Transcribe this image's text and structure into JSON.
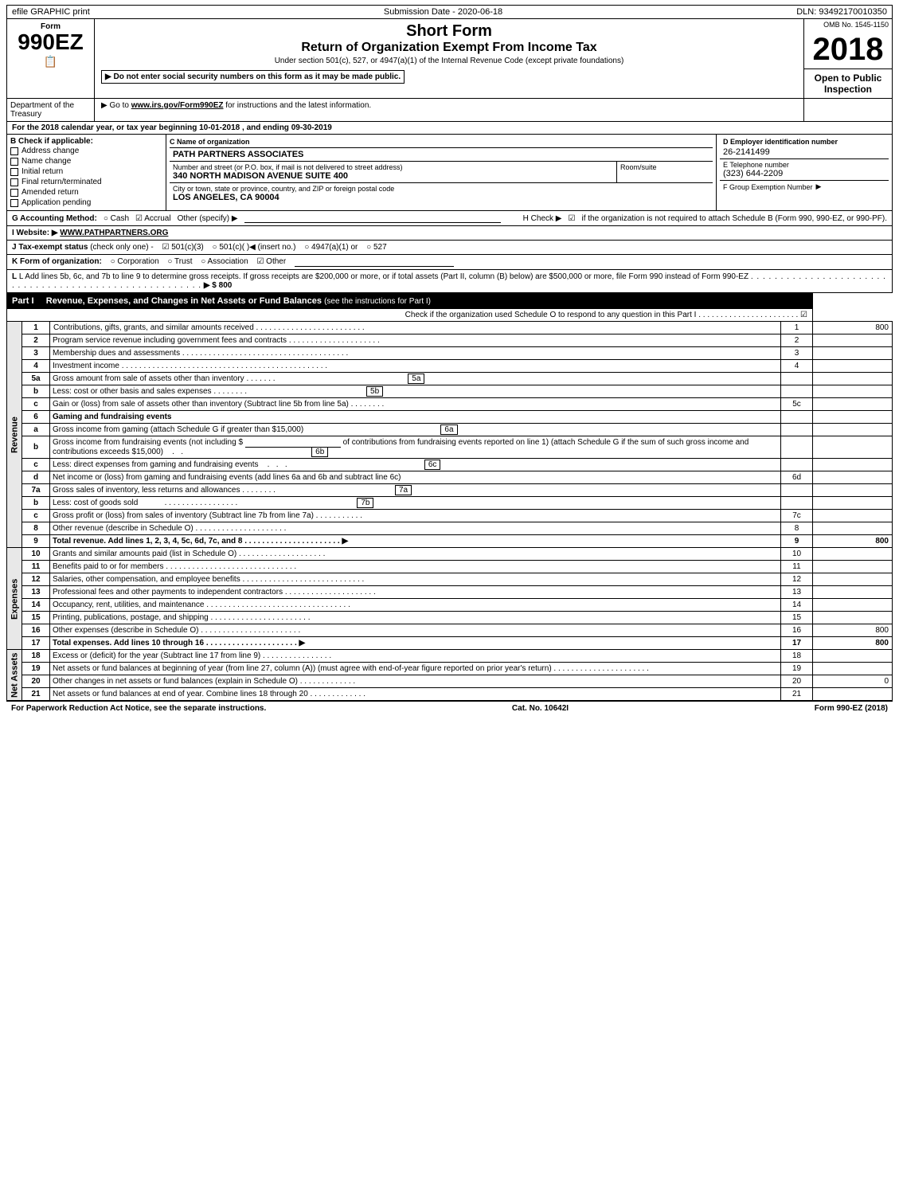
{
  "header": {
    "efile_label": "efile GRAPHIC print",
    "submission_label": "Submission Date - 2020-06-18",
    "dln_label": "DLN: 93492170010350"
  },
  "form": {
    "label": "Form",
    "number": "990EZ",
    "omb": "OMB No. 1545-1150",
    "short_form": "Short Form",
    "return_title": "Return of Organization Exempt From Income Tax",
    "under_section": "Under section 501(c), 527, or 4947(a)(1) of the Internal Revenue Code (except private foundations)",
    "do_not_enter": "▶ Do not enter social security numbers on this form as it may be made public.",
    "go_to": "▶ Go to",
    "go_to_link": "www.irs.gov/Form990EZ",
    "go_to_rest": "for instructions and the latest information.",
    "year": "2018",
    "open_to_public": "Open to Public Inspection"
  },
  "treasury": {
    "label": "Department of the Treasury"
  },
  "calendar": {
    "label": "For the 2018 calendar year, or tax year beginning 10-01-2018",
    "ending": ", and ending 09-30-2019"
  },
  "check": {
    "label": "B Check if applicable:",
    "options": [
      {
        "id": "address",
        "label": "Address change",
        "checked": false
      },
      {
        "id": "name",
        "label": "Name change",
        "checked": false
      },
      {
        "id": "initial",
        "label": "Initial return",
        "checked": false
      },
      {
        "id": "final",
        "label": "Final return/terminated",
        "checked": false
      },
      {
        "id": "amended",
        "label": "Amended return",
        "checked": false
      },
      {
        "id": "application",
        "label": "Application pending",
        "checked": false
      }
    ]
  },
  "org": {
    "c_label": "C Name of organization",
    "name": "PATH PARTNERS ASSOCIATES",
    "address_label": "Number and street (or P.O. box, if mail is not delivered to street address)",
    "address": "340 NORTH MADISON AVENUE SUITE 400",
    "room_label": "Room/suite",
    "room": "",
    "city_label": "City or town, state or province, country, and ZIP or foreign postal code",
    "city": "LOS ANGELES, CA  90004",
    "d_label": "D Employer identification number",
    "ein": "26-2141499",
    "e_label": "E Telephone number",
    "phone": "(323) 644-2209",
    "f_label": "F Group Exemption Number",
    "group_num": ""
  },
  "accounting": {
    "g_label": "G Accounting Method:",
    "cash": "○ Cash",
    "accrual": "☑ Accrual",
    "other": "Other (specify) ▶",
    "h_label": "H  Check ▶",
    "h_check": "☑",
    "h_text": "if the organization is not required to attach Schedule B (Form 990, 990-EZ, or 990-PF)."
  },
  "website": {
    "i_label": "I Website: ▶",
    "url": "WWW.PATHPARTNERS.ORG"
  },
  "tax_status": {
    "j_label": "J Tax-exempt status",
    "check_only": "(check only one) -",
    "options": [
      {
        "label": "☑ 501(c)(3)",
        "selected": true
      },
      {
        "label": "○ 501(c)(  )◀ (insert no.)",
        "selected": false
      },
      {
        "label": "○ 4947(a)(1) or",
        "selected": false
      },
      {
        "label": "○ 527",
        "selected": false
      }
    ]
  },
  "form_org": {
    "k_label": "K Form of organization:",
    "options": [
      {
        "label": "○ Corporation",
        "selected": false
      },
      {
        "label": "○ Trust",
        "selected": false
      },
      {
        "label": "○ Association",
        "selected": false
      },
      {
        "label": "☑ Other",
        "selected": true
      }
    ]
  },
  "add_lines": {
    "l_label": "L Add lines 5b, 6c, and 7b to line 9 to determine gross receipts. If gross receipts are $200,000 or more, or if total assets (Part II, column (B) below) are $500,000 or more, file Form 990 instead of Form 990-EZ",
    "dots": ". . . . . . . . . . . . . . . . . . . . . . . . . . . . . . . . . . . . . . . . . . . . . . . . . . . . . . . . . . . . . .",
    "arrow": "▶ $ 800"
  },
  "part1": {
    "label": "Part I",
    "title": "Revenue, Expenses, and Changes in Net Assets or Fund Balances",
    "subtitle": "(see the instructions for Part I)",
    "schedule_o_text": "Check if the organization used Schedule O to respond to any question in this Part I . . . . . . . . . . . . . . . . . . . . . . .",
    "schedule_o_check": "☑",
    "rows": [
      {
        "num": "1",
        "desc": "Contributions, gifts, grants, and similar amounts received . . . . . . . . . . . . . . . . . . . . . . . . . .",
        "line": "1",
        "amount": "800",
        "bold": false
      },
      {
        "num": "2",
        "desc": "Program service revenue including government fees and contracts . . . . . . . . . . . . . . . . . . . . . . . .",
        "line": "2",
        "amount": "",
        "bold": false
      },
      {
        "num": "3",
        "desc": "Membership dues and assessments . . . . . . . . . . . . . . . . . . . . . . . . . . . . . . . . . . . . . . .",
        "line": "3",
        "amount": "",
        "bold": false
      },
      {
        "num": "4",
        "desc": "Investment income . . . . . . . . . . . . . . . . . . . . . . . . . . . . . . . . . . . . . . . . . . . . . . .",
        "line": "4",
        "amount": "",
        "bold": false
      },
      {
        "num": "5a",
        "desc": "Gross amount from sale of assets other than inventory  .  .  .  .  .  .  .",
        "line": "5a",
        "amount": "",
        "bold": false,
        "sub": true
      },
      {
        "num": "b",
        "desc": "Less: cost or other basis and sales expenses  .  .  .  .  .  .  .  .",
        "line": "5b",
        "amount": "",
        "bold": false,
        "sub": true
      },
      {
        "num": "c",
        "desc": "Gain or (loss) from sale of assets other than inventory (Subtract line 5b from line 5a)  .  .  .  .  .  .  .  .",
        "line": "5c",
        "amount": "",
        "bold": false
      },
      {
        "num": "6",
        "desc": "Gaming and fundraising events",
        "line": "",
        "amount": "",
        "bold": false
      },
      {
        "num": "a",
        "desc": "Gross income from gaming (attach Schedule G if greater than $15,000)",
        "line": "6a",
        "amount": "",
        "bold": false,
        "sub": true
      },
      {
        "num": "b",
        "desc": "Gross income from fundraising events (not including $                           of contributions from fundraising events reported on line 1) (attach Schedule G if the sum of such gross income and contributions exceeds $15,000)     .     .",
        "line": "6b",
        "amount": "",
        "bold": false,
        "sub": true
      },
      {
        "num": "c",
        "desc": "Less: direct expenses from gaming and fundraising events     .     .     .",
        "line": "6c",
        "amount": "",
        "bold": false,
        "sub": true
      },
      {
        "num": "d",
        "desc": "Net income or (loss) from gaming and fundraising events (add lines 6a and 6b and subtract line 6c)",
        "line": "6d",
        "amount": "",
        "bold": false
      },
      {
        "num": "7a",
        "desc": "Gross sales of inventory, less returns and allowances  .  .  .  .  .  .  .  .",
        "line": "7a",
        "amount": "",
        "bold": false,
        "sub": true
      },
      {
        "num": "b",
        "desc": "Less: cost of goods sold       .  .  .  .  .  .  .  .  .  .  .  .  .  .  .  .  .  .",
        "line": "7b",
        "amount": "",
        "bold": false,
        "sub": true
      },
      {
        "num": "c",
        "desc": "Gross profit or (loss) from sales of inventory (Subtract line 7b from line 7a)  .  .  .  .  .  .  .  .  .  .  .",
        "line": "7c",
        "amount": "",
        "bold": false
      },
      {
        "num": "8",
        "desc": "Other revenue (describe in Schedule O)          .  .  .  .  .  .  .  .  .  .  .  .  .  .  .  .",
        "line": "8",
        "amount": "",
        "bold": false
      },
      {
        "num": "9",
        "desc": "Total revenue. Add lines 1, 2, 3, 4, 5c, 6d, 7c, and 8  .  .  .  .  .  .  .  .  .  .  .  .  .  .  .  .  .  .  .  .  .  .  . ▶",
        "line": "9",
        "amount": "800",
        "bold": true
      }
    ]
  },
  "expenses_rows": [
    {
      "num": "10",
      "desc": "Grants and similar amounts paid (list in Schedule O)          .  .  .  .  .  .  .  .  .  .  .  .  .  .  .  .",
      "line": "10",
      "amount": "",
      "bold": false
    },
    {
      "num": "11",
      "desc": "Benefits paid to or for members           .  .  .  .  .  .  .  .  .  .  .  .  .  .  .  .  .  .  .  .  .  .  .  .  .  .",
      "line": "11",
      "amount": "",
      "bold": false
    },
    {
      "num": "12",
      "desc": "Salaries, other compensation, and employee benefits . . . . . . . . . . . . . . . . . . . . . . . . . . . . .",
      "line": "12",
      "amount": "",
      "bold": false
    },
    {
      "num": "13",
      "desc": "Professional fees and other payments to independent contractors . . . . . . . . . . . . . . . . . . . . . . .",
      "line": "13",
      "amount": "",
      "bold": false
    },
    {
      "num": "14",
      "desc": "Occupancy, rent, utilities, and maintenance . . . . . . . . . . . . . . . . . . . . . . . . . . . . . . . . . .",
      "line": "14",
      "amount": "",
      "bold": false
    },
    {
      "num": "15",
      "desc": "Printing, publications, postage, and shipping     .  .  .  .  .  .  .  .  .  .  .  .  .  .  .  .  .  .  .  .  .  .",
      "line": "15",
      "amount": "",
      "bold": false
    },
    {
      "num": "16",
      "desc": "Other expenses (describe in Schedule O)          .  .  .  .  .  .  .  .  .  .  .  .  .  .  .  .  .  .  .  .  .  .",
      "line": "16",
      "amount": "800",
      "bold": false
    },
    {
      "num": "17",
      "desc": "Total expenses. Add lines 10 through 16          .  .  .  .  .  .  .  .  .  .  .  .  .  .  .  .  .  .  .  .  . ▶",
      "line": "17",
      "amount": "800",
      "bold": true
    }
  ],
  "net_assets_rows": [
    {
      "num": "18",
      "desc": "Excess or (deficit) for the year (Subtract line 17 from line 9)     .  .  .  .  .  .  .  .  .  .  .  .  .  .  .  .",
      "line": "18",
      "amount": "",
      "bold": false
    },
    {
      "num": "19",
      "desc": "Net assets or fund balances at beginning of year (from line 27, column (A)) (must agree with end-of-year figure reported on prior year's return)          .  .  .  .  .  .  .  .  .  .  .  .  .  .  .  .  .  .  .  .  .  .",
      "line": "19",
      "amount": "",
      "bold": false
    },
    {
      "num": "20",
      "desc": "Other changes in net assets or fund balances (explain in Schedule O)  .  .  .  .  .  .  .  .  .  .  .  .  .  .",
      "line": "20",
      "amount": "0",
      "bold": false
    },
    {
      "num": "21",
      "desc": "Net assets or fund balances at end of year. Combine lines 18 through 20  .  .  .  .  .  .  .  .  .  .  .  .  .",
      "line": "21",
      "amount": "",
      "bold": false
    }
  ],
  "footer": {
    "paperwork": "For Paperwork Reduction Act Notice, see the separate instructions.",
    "cat_no": "Cat. No. 10642I",
    "form_ref": "Form 990-EZ (2018)"
  }
}
